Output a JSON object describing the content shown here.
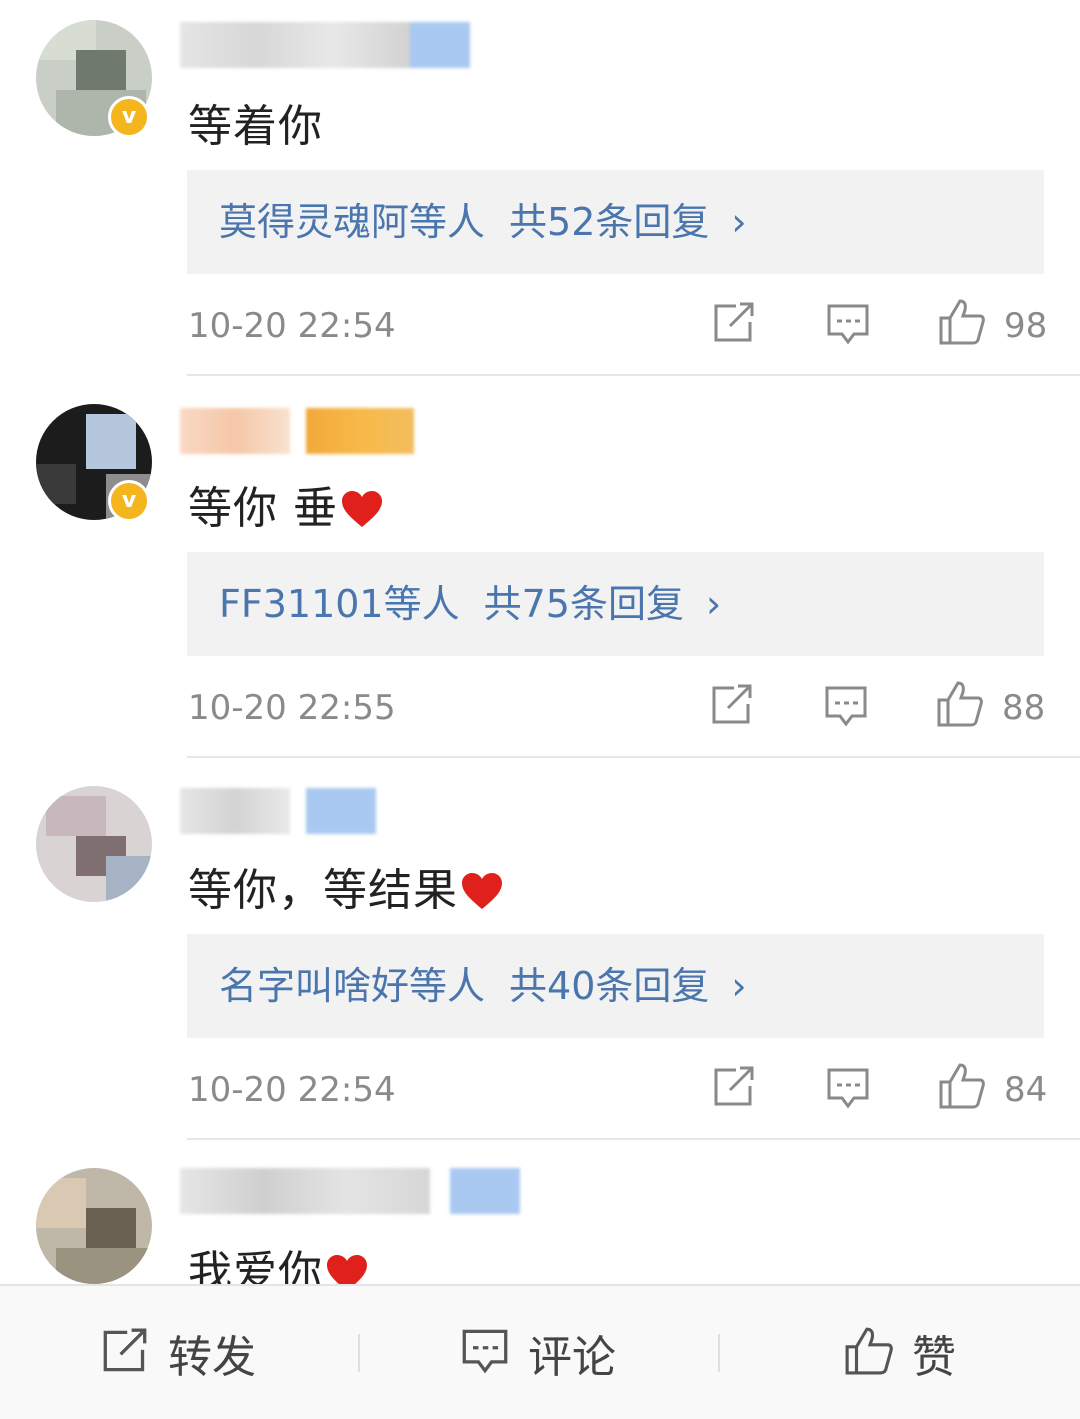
{
  "comments": [
    {
      "text": "等着你",
      "heart": false,
      "replies": {
        "names": "莫得灵魂阿等人",
        "count": "共52条回复",
        "chevron": "›"
      },
      "time": "10-20 22:54",
      "likes": "98"
    },
    {
      "text": "等你 垂",
      "heart": true,
      "replies": {
        "names": "FF31101等人",
        "count": "共75条回复",
        "chevron": "›"
      },
      "time": "10-20 22:55",
      "likes": "88"
    },
    {
      "text": "等你，等结果",
      "heart": true,
      "replies": {
        "names": "名字叫啥好等人",
        "count": "共40条回复",
        "chevron": "›"
      },
      "time": "10-20 22:54",
      "likes": "84"
    },
    {
      "text": "我爱你",
      "heart": true
    }
  ],
  "toolbar": {
    "repost_label": "转发",
    "comment_label": "评论",
    "like_label": "赞"
  },
  "icons": [
    "share-icon",
    "comment-icon",
    "thumbs-up-icon",
    "verified-badge-icon",
    "heart-icon",
    "chevron-right-icon"
  ],
  "colors": {
    "link": "#4a75ad",
    "badge": "#f5b51d",
    "heart": "#e0201b"
  }
}
